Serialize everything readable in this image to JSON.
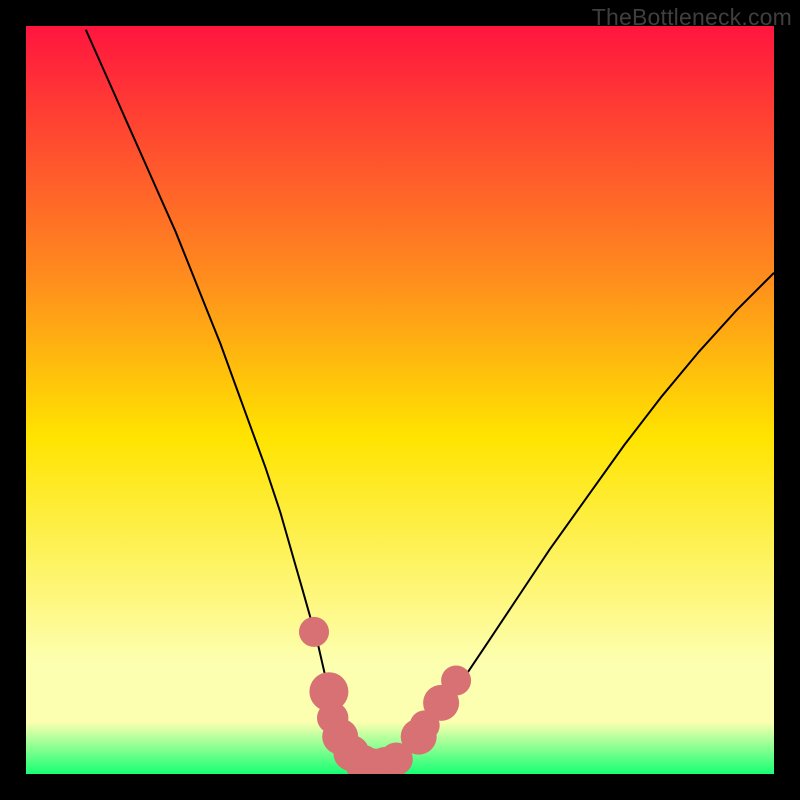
{
  "watermark": "TheBottleneck.com",
  "colors": {
    "gradient_top": "#ff153f",
    "gradient_mid_upper": "#ff8a1e",
    "gradient_mid": "#ffe400",
    "gradient_lower": "#fdffb0",
    "gradient_bottom": "#17ff73",
    "curve": "#000000",
    "dot": "#d87173"
  },
  "chart_data": {
    "type": "line",
    "title": "",
    "xlabel": "",
    "ylabel": "",
    "xlim": [
      0,
      100
    ],
    "ylim": [
      0,
      100
    ],
    "series": [
      {
        "name": "bottleneck-curve",
        "x": [
          8,
          10,
          12,
          14,
          16,
          18,
          20,
          22,
          24,
          26,
          28,
          30,
          32,
          34,
          35,
          36,
          37,
          38,
          39,
          39.8,
          40.6,
          41.4,
          42.2,
          43,
          44,
          45,
          46,
          47,
          48,
          50,
          52,
          55,
          58,
          62,
          66,
          70,
          75,
          80,
          85,
          90,
          95,
          100
        ],
        "y": [
          99.5,
          95,
          90.5,
          86,
          81.5,
          77,
          72.5,
          67.5,
          62.5,
          57.5,
          52,
          46.5,
          41,
          35,
          31.5,
          28,
          24.5,
          21,
          17.5,
          14,
          10.5,
          7.5,
          5,
          3.2,
          1.8,
          1,
          0.6,
          0.6,
          1,
          2.2,
          4.2,
          7.8,
          12,
          18,
          24,
          30,
          37,
          44,
          50.5,
          56.5,
          62,
          67
        ]
      }
    ],
    "dots": {
      "name": "highlight-dots",
      "points": [
        {
          "x": 38.5,
          "y": 19,
          "r": 1.2
        },
        {
          "x": 40.5,
          "y": 11,
          "r": 1.8
        },
        {
          "x": 41.0,
          "y": 7.5,
          "r": 1.3
        },
        {
          "x": 42.0,
          "y": 5.0,
          "r": 1.6
        },
        {
          "x": 43.5,
          "y": 2.8,
          "r": 1.6
        },
        {
          "x": 45.0,
          "y": 1.5,
          "r": 1.6
        },
        {
          "x": 46.5,
          "y": 1.0,
          "r": 1.6
        },
        {
          "x": 48.0,
          "y": 1.2,
          "r": 1.6
        },
        {
          "x": 49.5,
          "y": 2.0,
          "r": 1.4
        },
        {
          "x": 52.5,
          "y": 5.0,
          "r": 1.6
        },
        {
          "x": 53.3,
          "y": 6.5,
          "r": 1.2
        },
        {
          "x": 55.5,
          "y": 9.5,
          "r": 1.6
        },
        {
          "x": 57.5,
          "y": 12.5,
          "r": 1.2
        }
      ]
    }
  }
}
